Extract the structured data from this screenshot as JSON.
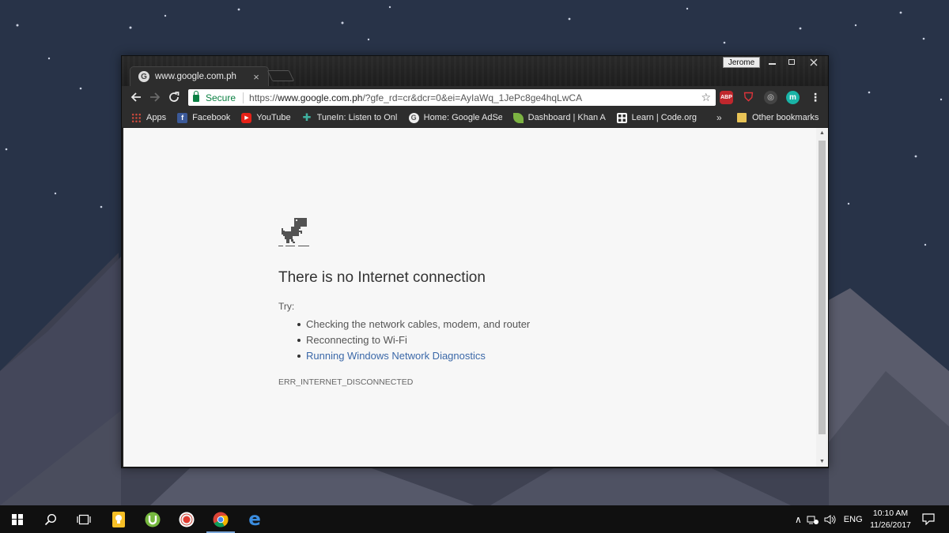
{
  "desktop": {
    "colors": {
      "sky": "#283348",
      "mountain": "#4c4f5e",
      "mountain_light": "#5a5c6c",
      "star": "#c9d0e0"
    }
  },
  "browser": {
    "profile_name": "Jerome",
    "tab": {
      "favicon": "G",
      "title": "www.google.com.ph",
      "close": "×"
    },
    "omnibox": {
      "secure_label": "Secure",
      "url_scheme": "https://",
      "url_host": "www.google.com.ph",
      "url_rest": "/?gfe_rd=cr&dcr=0&ei=AyIaWq_1JePc8ge4hqLwCA"
    },
    "extensions": {
      "abp": "ABP",
      "m": "m"
    },
    "bookmarks": [
      {
        "label": "Apps",
        "icon": "apps-grid-icon"
      },
      {
        "label": "Facebook",
        "icon": "facebook-icon"
      },
      {
        "label": "YouTube",
        "icon": "youtube-icon"
      },
      {
        "label": "TuneIn: Listen to Onli",
        "icon": "tunein-icon"
      },
      {
        "label": "Home: Google AdSer",
        "icon": "google-icon"
      },
      {
        "label": "Dashboard | Khan Ac",
        "icon": "khan-leaf-icon"
      },
      {
        "label": "Learn | Code.org",
        "icon": "codeorg-icon"
      }
    ],
    "bookmarks_overflow": "»",
    "other_bookmarks": "Other bookmarks"
  },
  "error_page": {
    "title": "There is no Internet connection",
    "try_label": "Try:",
    "suggestions": [
      "Checking the network cables, modem, and router",
      "Reconnecting to Wi-Fi",
      "Running Windows Network Diagnostics"
    ],
    "error_code": "ERR_INTERNET_DISCONNECTED",
    "link_color": "#3b68a8"
  },
  "taskbar": {
    "language": "ENG",
    "time": "10:10 AM",
    "date": "11/26/2017"
  }
}
